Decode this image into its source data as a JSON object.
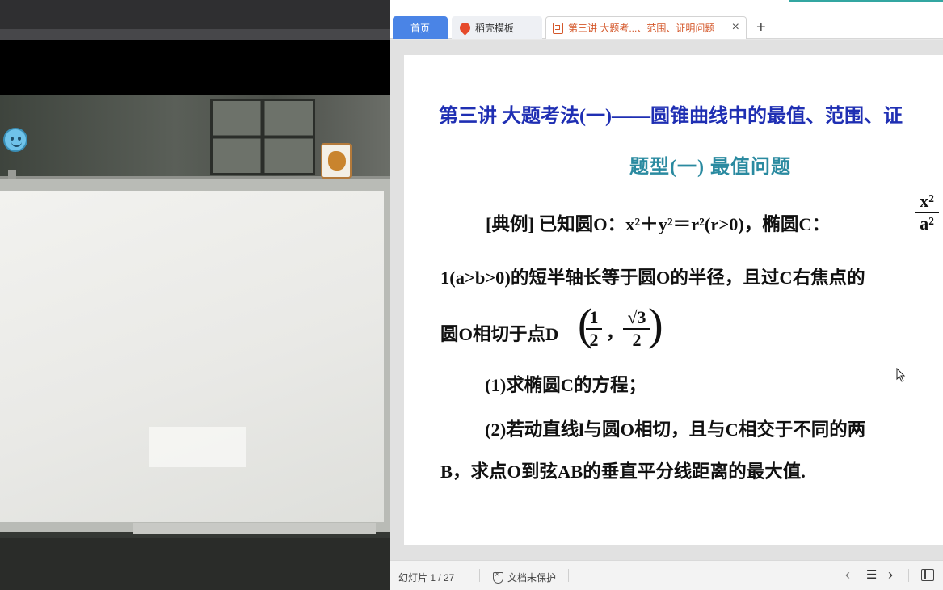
{
  "tabs": {
    "home": "首页",
    "templates": "稻壳模板",
    "document": "第三讲  大题考...、范围、证明问题",
    "close": "×",
    "add": "+"
  },
  "slide": {
    "title": "第三讲  大题考法(一)——圆锥曲线中的最值、范围、证",
    "subtitle": "题型(一)    最值问题",
    "line1": "[典例]    已知圆O：x²＋y²＝r²(r>0)，椭圆C：",
    "ellipse_num": "x²",
    "ellipse_den": "a²",
    "line2": "1(a>b>0)的短半轴长等于圆O的半径，且过C右焦点的",
    "line3_prefix": "圆O相切于点D",
    "point_x_num": "1",
    "point_x_den": "2",
    "point_y_num": "√3",
    "point_y_den": "2",
    "comma": "，",
    "period": ".",
    "paren_left": "(",
    "paren_right": ")",
    "q1": "(1)求椭圆C的方程；",
    "q2": "(2)若动直线l与圆O相切，且与C相交于不同的两",
    "q2_cont": "B，求点O到弦AB的垂直平分线距离的最大值."
  },
  "status": {
    "slide_counter": "幻灯片 1 / 27",
    "protection": "文档未保护",
    "prev": "‹",
    "list": "☰",
    "next": "›"
  },
  "colors": {
    "title": "#1f2fb3",
    "subtitle": "#2a8aa0",
    "home_tab": "#4a84e6",
    "doc_tab_text": "#d4572a"
  }
}
